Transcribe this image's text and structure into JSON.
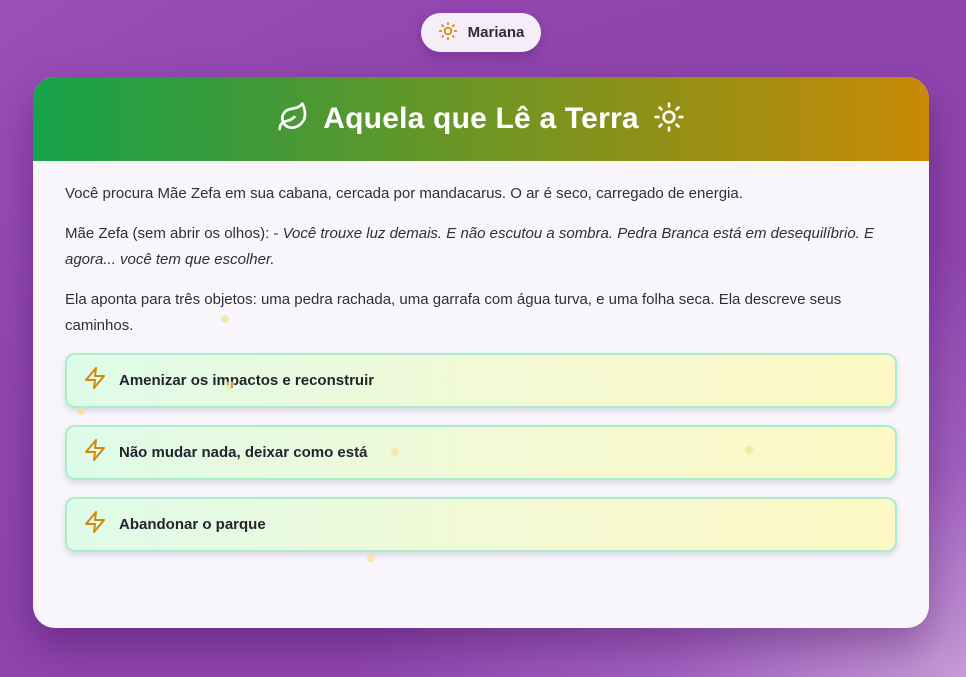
{
  "player": {
    "name": "Mariana",
    "icon": "sun-icon"
  },
  "card": {
    "title": "Aquela que Lê a Terra",
    "title_icon_left": "leaf-icon",
    "title_icon_right": "sun-icon",
    "paragraphs": {
      "p1": "Você procura Mãe Zefa em sua cabana, cercada por mandacarus. O ar é seco, carregado de energia.",
      "p2_prefix": "Mãe Zefa (sem abrir os olhos): - ",
      "p2_quote": "Você trouxe luz demais. E não escutou a sombra. Pedra Branca está em desequilíbrio. E agora... você tem que escolher.",
      "p3": "Ela aponta para três objetos: uma pedra rachada, uma garrafa com água turva, e uma folha seca. Ela descreve seus caminhos."
    },
    "choices": [
      {
        "label": "Amenizar os impactos e reconstruir",
        "icon": "lightning-icon"
      },
      {
        "label": "Não mudar nada, deixar como está",
        "icon": "lightning-icon"
      },
      {
        "label": "Abandonar o parque",
        "icon": "lightning-icon"
      }
    ]
  },
  "colors": {
    "background": "#8e44ad",
    "header_start": "#16a34a",
    "header_end": "#c98a06",
    "icon_amber": "#d4870a",
    "choice_border": "#a7efc8"
  }
}
